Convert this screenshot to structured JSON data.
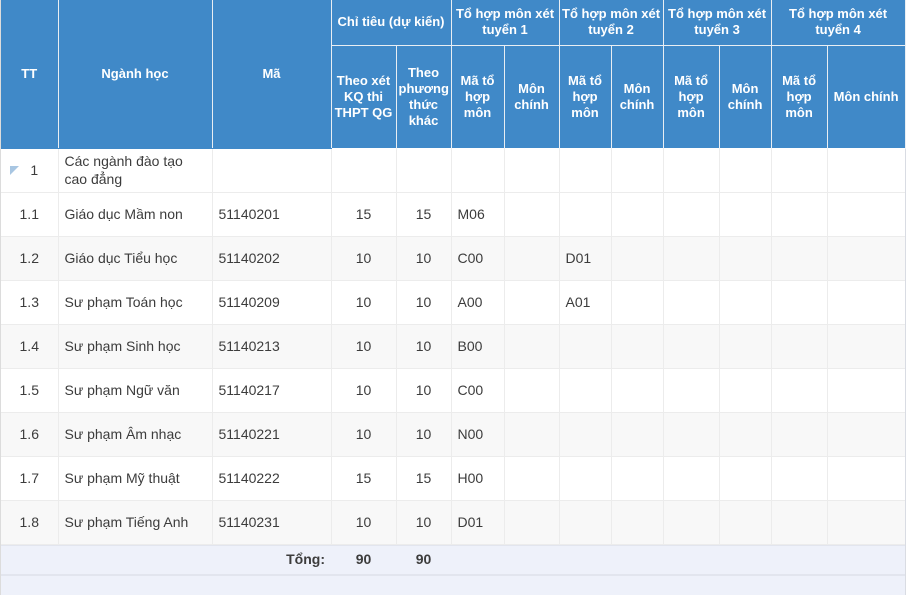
{
  "table": {
    "header": {
      "tt": "TT",
      "nganh_hoc": "Ngành học",
      "ma": "Mã",
      "chi_tieu_group": "Chỉ tiêu (dự kiến)",
      "chi_tieu_thpt": "Theo xét KQ thi THPT QG",
      "chi_tieu_khac": "Theo phương thức khác",
      "to_hop_1": "Tổ hợp môn xét tuyển 1",
      "to_hop_2": "Tổ hợp môn xét tuyển 2",
      "to_hop_3": "Tổ hợp môn xét tuyển 3",
      "to_hop_4": "Tổ hợp môn xét tuyển 4",
      "ma_to_hop_mon": "Mã tổ hợp môn",
      "mon_chinh": "Môn chính"
    },
    "group_row": {
      "tt": "1",
      "name": "Các ngành đào tạo cao đẳng",
      "collapse_icon": "triangle-collapse-icon"
    },
    "rows": [
      {
        "tt": "1.1",
        "name": "Giáo dục Mầm non",
        "ma": "51140201",
        "ct_thpt": "15",
        "ct_khac": "15",
        "th1_ma": "M06",
        "th1_mon": "",
        "th2_ma": "",
        "th2_mon": "",
        "th3_ma": "",
        "th3_mon": "",
        "th4_ma": "",
        "th4_mon": ""
      },
      {
        "tt": "1.2",
        "name": "Giáo dục Tiểu học",
        "ma": "51140202",
        "ct_thpt": "10",
        "ct_khac": "10",
        "th1_ma": "C00",
        "th1_mon": "",
        "th2_ma": "D01",
        "th2_mon": "",
        "th3_ma": "",
        "th3_mon": "",
        "th4_ma": "",
        "th4_mon": ""
      },
      {
        "tt": "1.3",
        "name": "Sư phạm Toán học",
        "ma": "51140209",
        "ct_thpt": "10",
        "ct_khac": "10",
        "th1_ma": "A00",
        "th1_mon": "",
        "th2_ma": "A01",
        "th2_mon": "",
        "th3_ma": "",
        "th3_mon": "",
        "th4_ma": "",
        "th4_mon": ""
      },
      {
        "tt": "1.4",
        "name": "Sư phạm Sinh học",
        "ma": "51140213",
        "ct_thpt": "10",
        "ct_khac": "10",
        "th1_ma": "B00",
        "th1_mon": "",
        "th2_ma": "",
        "th2_mon": "",
        "th3_ma": "",
        "th3_mon": "",
        "th4_ma": "",
        "th4_mon": ""
      },
      {
        "tt": "1.5",
        "name": "Sư phạm Ngữ văn",
        "ma": "51140217",
        "ct_thpt": "10",
        "ct_khac": "10",
        "th1_ma": "C00",
        "th1_mon": "",
        "th2_ma": "",
        "th2_mon": "",
        "th3_ma": "",
        "th3_mon": "",
        "th4_ma": "",
        "th4_mon": ""
      },
      {
        "tt": "1.6",
        "name": "Sư phạm Âm nhạc",
        "ma": "51140221",
        "ct_thpt": "10",
        "ct_khac": "10",
        "th1_ma": "N00",
        "th1_mon": "",
        "th2_ma": "",
        "th2_mon": "",
        "th3_ma": "",
        "th3_mon": "",
        "th4_ma": "",
        "th4_mon": ""
      },
      {
        "tt": "1.7",
        "name": "Sư phạm Mỹ thuật",
        "ma": "51140222",
        "ct_thpt": "15",
        "ct_khac": "15",
        "th1_ma": "H00",
        "th1_mon": "",
        "th2_ma": "",
        "th2_mon": "",
        "th3_ma": "",
        "th3_mon": "",
        "th4_ma": "",
        "th4_mon": ""
      },
      {
        "tt": "1.8",
        "name": "Sư phạm Tiếng Anh",
        "ma": "51140231",
        "ct_thpt": "10",
        "ct_khac": "10",
        "th1_ma": "D01",
        "th1_mon": "",
        "th2_ma": "",
        "th2_mon": "",
        "th3_ma": "",
        "th3_mon": "",
        "th4_ma": "",
        "th4_mon": ""
      }
    ],
    "footer": {
      "label": "Tổng:",
      "total_thpt": "90",
      "total_khac": "90"
    },
    "colors": {
      "header_blue": "#4089c8",
      "header_text": "#ffffff",
      "row_alt": "#f8f8f8",
      "footer_bg": "#eef1fa",
      "grid_line": "#ececec",
      "collapse_icon": "#a8c6e2"
    }
  }
}
